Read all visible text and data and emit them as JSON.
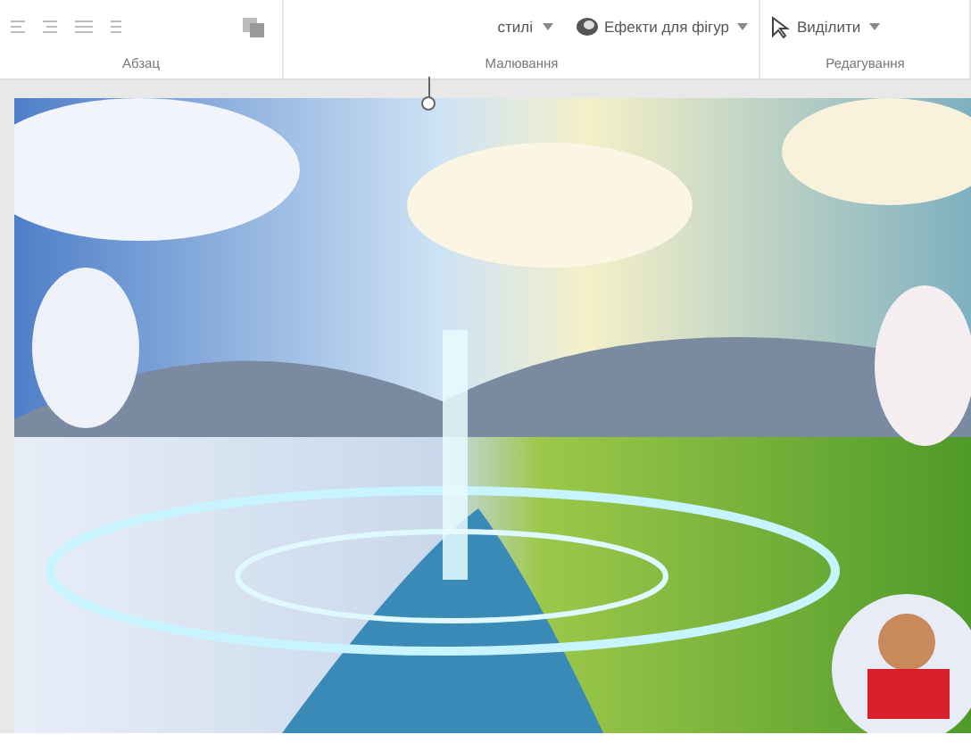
{
  "ribbon": {
    "groups": [
      {
        "label": "Абзац"
      },
      {
        "label": "Малювання"
      },
      {
        "label": "Редагування"
      }
    ],
    "buttons": [
      {
        "label": "стилі",
        "kind": "dropdown"
      },
      {
        "label": "Ефекти для фігур",
        "kind": "effects"
      },
      {
        "label": "Виділити",
        "kind": "select"
      }
    ]
  }
}
